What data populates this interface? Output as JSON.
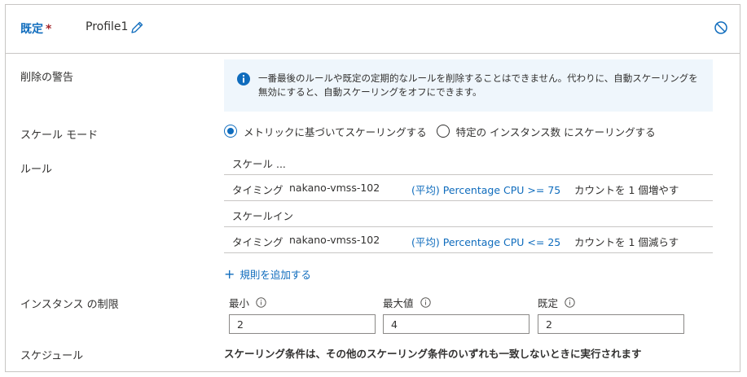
{
  "profile": {
    "type_label": "既定",
    "required_mark": "*",
    "name": "Profile1"
  },
  "labels": {
    "delete_warning": "削除の警告",
    "scale_mode": "スケール モード",
    "rules": "ルール",
    "instance_limits": "インスタンス の制限",
    "schedule": "スケジュール"
  },
  "warning": {
    "text": "一番最後のルールや既定の定期的なルールを削除することはできません。代わりに、自動スケーリングを無効にすると、自動スケーリングをオフにできます。"
  },
  "scale_mode": {
    "options": [
      {
        "label": "メトリックに基づいてスケーリングする",
        "checked": true
      },
      {
        "label": "特定の インスタンス数 にスケーリングする",
        "checked": false
      }
    ]
  },
  "rules": {
    "scale_out_title": "スケール ...",
    "scale_in_title": "スケールイン",
    "rows": [
      {
        "timing": "タイミング",
        "resource": "nakano-vmss-102",
        "metric": "(平均) Percentage CPU >= 75",
        "action": "カウントを 1 個増やす"
      },
      {
        "timing": "タイミング",
        "resource": "nakano-vmss-102",
        "metric": "(平均) Percentage CPU <= 25",
        "action": "カウントを 1 個減らす"
      }
    ],
    "add_rule": "規則を追加する"
  },
  "limits": {
    "min": {
      "label": "最小",
      "value": "2"
    },
    "max": {
      "label": "最大値",
      "value": "4"
    },
    "default": {
      "label": "既定",
      "value": "2"
    }
  },
  "schedule": {
    "text": "スケーリング条件は、その他のスケーリング条件のいずれも一致しないときに実行されます"
  },
  "colors": {
    "accent": "#0f6cbd",
    "warning_bg": "#eff6fc",
    "required": "#a4262c"
  },
  "icons": {
    "edit": "pencil-icon",
    "delete": "disabled-circle-icon",
    "info": "info-icon",
    "add": "plus-icon"
  }
}
